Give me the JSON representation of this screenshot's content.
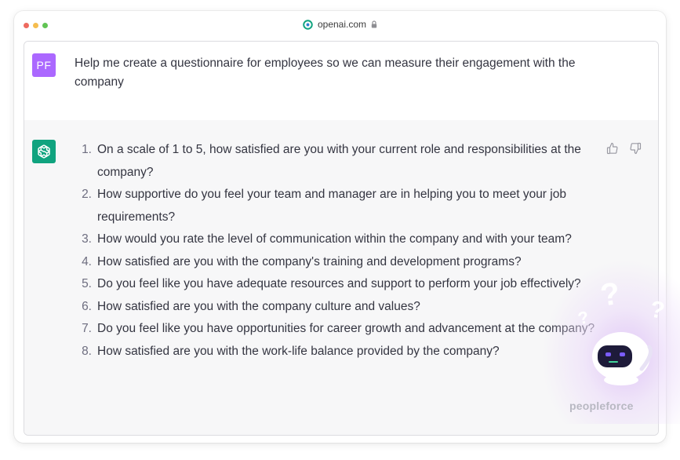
{
  "browser": {
    "url": "openai.com"
  },
  "user": {
    "initials": "PF",
    "message": "Help me create a questionnaire for employees so we can measure their engagement with the company"
  },
  "assistant": {
    "items": [
      {
        "num": "1.",
        "text": "On a scale of 1 to 5, how satisfied are you with your current role and responsibilities at the company?"
      },
      {
        "num": "2.",
        "text": "How supportive do you feel your team and manager are in helping you to meet your job requirements?"
      },
      {
        "num": "3.",
        "text": "How would you rate the level of communication within the company and with your team?"
      },
      {
        "num": "4.",
        "text": "How satisfied are you with the company's training and development programs?"
      },
      {
        "num": "5.",
        "text": "Do you feel like you have adequate resources and support to perform your job effectively?"
      },
      {
        "num": "6.",
        "text": "How satisfied are you with the company culture and values?"
      },
      {
        "num": "7.",
        "text": "Do you feel like you have opportunities for career growth and advancement at the company?"
      },
      {
        "num": "8.",
        "text": "How satisfied are you with the work-life balance provided by the company?"
      }
    ]
  },
  "watermark": {
    "brand": "peopleforce"
  },
  "colors": {
    "user_avatar": "#ab68ff",
    "assistant_avatar": "#10a37f",
    "assistant_bg": "#f7f7f8",
    "text": "#343541"
  },
  "icons": [
    "openai-logo-icon",
    "lock-icon",
    "chatgpt-logo-icon",
    "thumbs-up-icon",
    "thumbs-down-icon",
    "robot-mascot-icon"
  ]
}
